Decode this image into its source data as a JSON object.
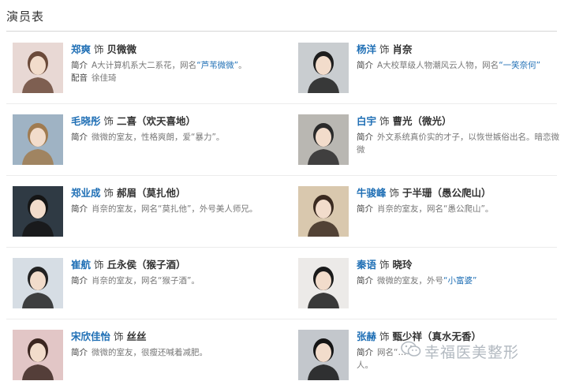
{
  "header": {
    "title": "演员表"
  },
  "cast": [
    {
      "actor": "郑爽",
      "as": "饰",
      "role": "贝微微",
      "photo_tone": "#e8d8d4",
      "hair": "#6b4a3a",
      "intro_key": "简介",
      "intro_parts": [
        "A大计算机系大二系花，网名",
        "“芦苇微微”",
        "。"
      ],
      "voice_key": "配音",
      "voice": "徐佳琦"
    },
    {
      "actor": "杨洋",
      "as": "饰",
      "role": "肖奈",
      "photo_tone": "#c9cdd0",
      "hair": "#1d1d1d",
      "intro_key": "简介",
      "intro_parts": [
        "A大校草级人物潮风云人物，网名",
        "“一笑奈何”",
        ""
      ]
    },
    {
      "actor": "毛晓彤",
      "as": "饰",
      "role": "二喜（欢天喜地）",
      "photo_tone": "#9fb3c4",
      "hair": "#a07b50",
      "intro_key": "简介",
      "intro_parts": [
        "微微的室友，性格爽朗，爱“暴力”。",
        "",
        ""
      ]
    },
    {
      "actor": "白宇",
      "as": "饰",
      "role": "曹光（微光）",
      "photo_tone": "#b9b7b2",
      "hair": "#2a2a2a",
      "intro_key": "简介",
      "intro_parts": [
        "外文系统真价实的才子，以恢世嫉俗出名。暗恋微微",
        "",
        ""
      ]
    },
    {
      "actor": "郑业成",
      "as": "饰",
      "role": "郝眉（莫扎他）",
      "photo_tone": "#2f3a44",
      "hair": "#151515",
      "intro_key": "简介",
      "intro_parts": [
        "肖奈的室友，网名“莫扎他”，外号美人师兄。",
        "",
        ""
      ]
    },
    {
      "actor": "牛骏峰",
      "as": "饰",
      "role": "于半珊（愚公爬山）",
      "photo_tone": "#d9c8ae",
      "hair": "#3a2a20",
      "intro_key": "简介",
      "intro_parts": [
        "肖奈的室友，网名“愚公爬山”。",
        "",
        ""
      ]
    },
    {
      "actor": "崔航",
      "as": "饰",
      "role": "丘永侯（猴子酒）",
      "photo_tone": "#d6dde4",
      "hair": "#222222",
      "intro_key": "简介",
      "intro_parts": [
        "肖奈的室友，网名“猴子酒”。",
        "",
        ""
      ]
    },
    {
      "actor": "秦语",
      "as": "饰",
      "role": "晓玲",
      "photo_tone": "#eceae8",
      "hair": "#1a1a1a",
      "intro_key": "简介",
      "intro_parts": [
        "微微的室友，外号",
        "“小富婆”",
        ""
      ]
    },
    {
      "actor": "宋欣佳怡",
      "as": "饰",
      "role": "丝丝",
      "photo_tone": "#e2c6c6",
      "hair": "#3b2620",
      "intro_key": "简介",
      "intro_parts": [
        "微微的室友，很瘦还喊着减肥。",
        "",
        ""
      ]
    },
    {
      "actor": "张赫",
      "as": "饰",
      "role": "甄少祥（真水无香）",
      "photo_tone": "#c3c7cc",
      "hair": "#151515",
      "intro_key": "简介",
      "intro_parts": [
        "网名“…",
        "",
        ""
      ],
      "tail": "人。"
    }
  ],
  "watermark": {
    "text": "幸福医美整形"
  },
  "colors": {
    "accent": "#1f6fb5",
    "muted": "#777777",
    "rule": "#d6d6d6"
  }
}
